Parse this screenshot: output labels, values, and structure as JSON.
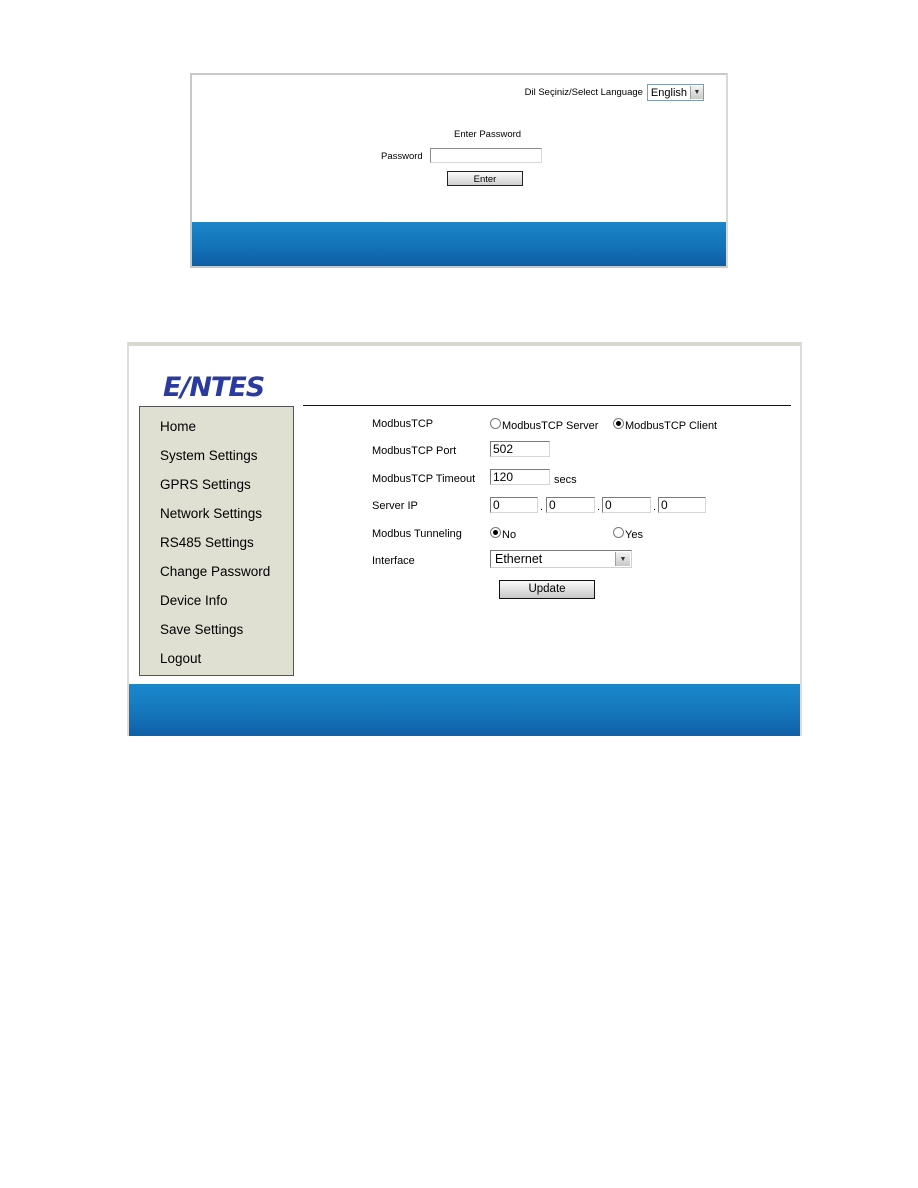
{
  "login": {
    "language_label": "Dil Seçiniz/Select Language",
    "language_value": "English",
    "title": "Enter Password",
    "password_label": "Password",
    "password_value": "",
    "enter_label": "Enter"
  },
  "settings": {
    "logo": {
      "pre": "E",
      "slash": "/",
      "post": "NTES"
    },
    "sidebar": {
      "items": [
        {
          "label": "Home"
        },
        {
          "label": "System Settings"
        },
        {
          "label": "GPRS Settings"
        },
        {
          "label": "Network Settings"
        },
        {
          "label": "RS485 Settings"
        },
        {
          "label": "Change Password"
        },
        {
          "label": "Device Info"
        },
        {
          "label": "Save Settings"
        },
        {
          "label": "Logout"
        }
      ]
    },
    "form": {
      "modbustcp_label": "ModbusTCP",
      "mode_server_label": "ModbusTCP Server",
      "mode_client_label": "ModbusTCP Client",
      "mode_selected": "client",
      "port_label": "ModbusTCP Port",
      "port_value": "502",
      "timeout_label": "ModbusTCP Timeout",
      "timeout_value": "120",
      "timeout_unit": "secs",
      "server_ip_label": "Server IP",
      "server_ip": [
        "0",
        "0",
        "0",
        "0"
      ],
      "ip_separator": ".",
      "tunneling_label": "Modbus Tunneling",
      "tunneling_no_label": "No",
      "tunneling_yes_label": "Yes",
      "tunneling_selected": "no",
      "interface_label": "Interface",
      "interface_value": "Ethernet",
      "update_label": "Update"
    }
  },
  "colors": {
    "footer_blue": "#1676bb",
    "sidebar_bg": "#dfe0d2",
    "logo_blue": "#2a3a9e"
  }
}
